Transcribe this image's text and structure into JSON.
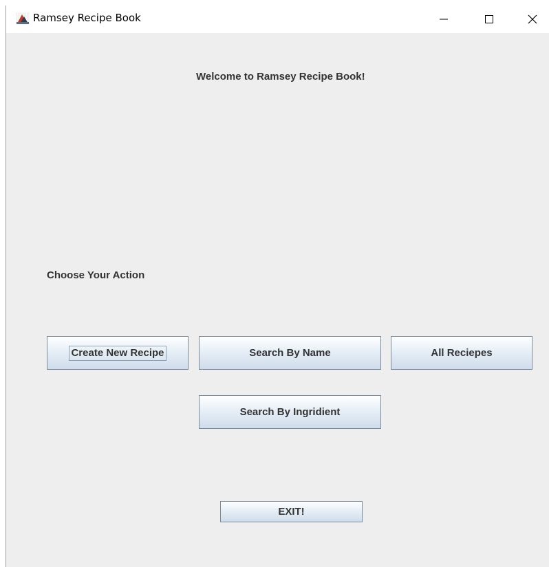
{
  "window": {
    "title": "Ramsey Recipe Book",
    "icon": "java-app-icon",
    "controls": {
      "minimize": "minimize-icon",
      "maximize": "maximize-icon",
      "close": "close-icon"
    }
  },
  "main": {
    "welcome_text": "Welcome to Ramsey Recipe Book!",
    "choose_label": "Choose Your Action",
    "buttons": {
      "create_new_recipe": "Create New Recipe",
      "search_by_name": "Search By Name",
      "all_recipes": "All Reciepes",
      "search_by_ingredient": "Search By Ingridient",
      "exit": "EXIT!"
    }
  },
  "colors": {
    "window_background": "#eeeeee",
    "titlebar_background": "#ffffff",
    "text": "#333333",
    "button_border": "#7a8a99"
  }
}
